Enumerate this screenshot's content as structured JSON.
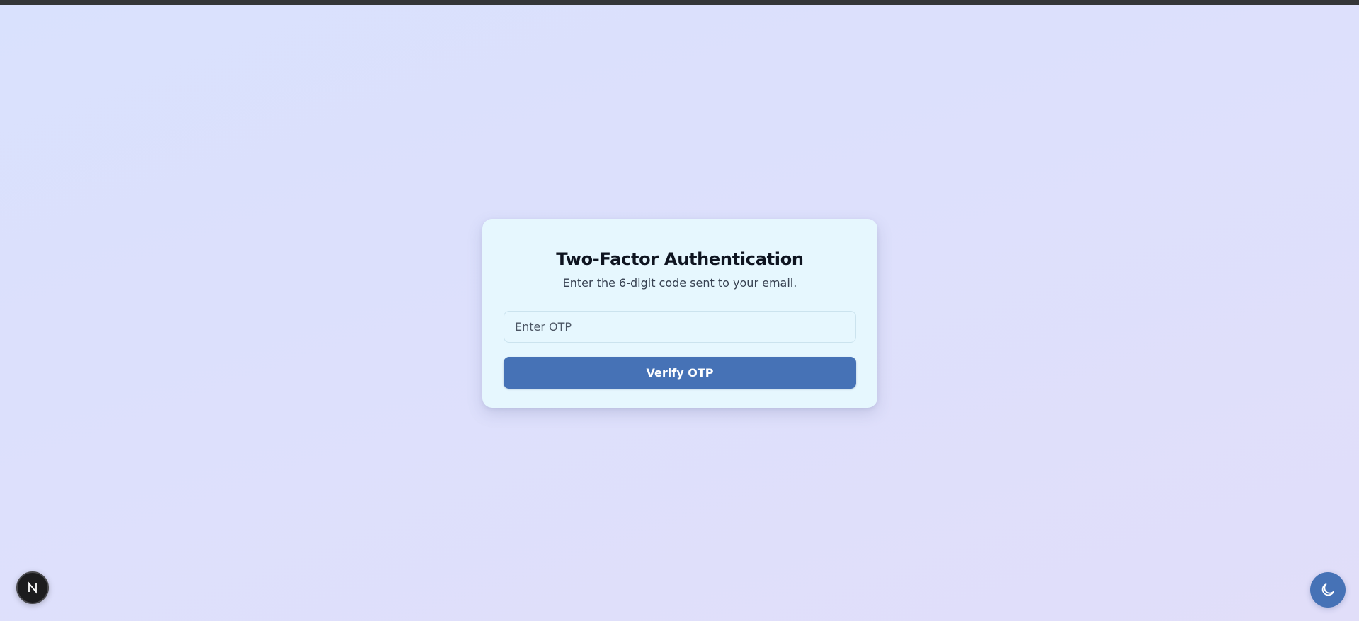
{
  "auth_card": {
    "title": "Two-Factor Authentication",
    "subtitle": "Enter the 6-digit code sent to your email.",
    "otp_field": {
      "value": "",
      "placeholder": "Enter OTP"
    },
    "verify_button_label": "Verify OTP"
  },
  "dev_tools_badge": {
    "icon": "nextjs-logo-icon"
  },
  "theme_toggle": {
    "icon": "moon-icon"
  },
  "colors": {
    "accent": "#4672b6",
    "card_background": "#e6f7fe",
    "page_background": "#dde0fc",
    "top_bar": "#343638"
  }
}
